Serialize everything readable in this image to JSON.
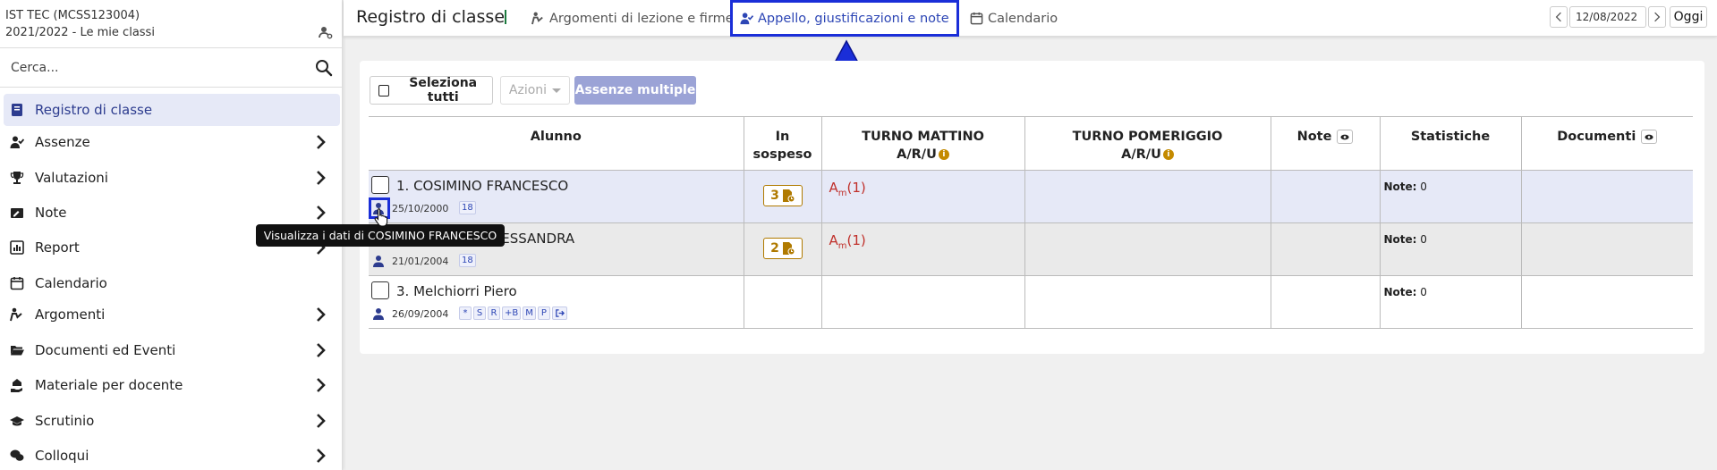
{
  "sidebar": {
    "school_name": "IST TEC (MCSS123004)",
    "school_year": "2021/2022 - Le mie classi",
    "search_placeholder": "Cerca...",
    "items": [
      {
        "label": "Registro di classe",
        "icon": "book-icon",
        "active": true,
        "chevron": false
      },
      {
        "label": "Assenze",
        "icon": "user-check-icon",
        "chevron": true
      },
      {
        "label": "Valutazioni",
        "icon": "trophy-icon",
        "chevron": true
      },
      {
        "label": "Note",
        "icon": "note-edit-icon",
        "chevron": true
      },
      {
        "label": "Report",
        "icon": "chart-icon",
        "chevron": true
      },
      {
        "label": "Calendario",
        "icon": "calendar-icon",
        "chevron": false
      },
      {
        "label": "Argomenti",
        "icon": "person-chalkboard-icon",
        "chevron": true
      },
      {
        "label": "Documenti ed Eventi",
        "icon": "folder-open-icon",
        "chevron": true
      },
      {
        "label": "Materiale per docente",
        "icon": "hand-holding-icon",
        "chevron": true
      },
      {
        "label": "Scrutinio",
        "icon": "graduation-cap-icon",
        "chevron": true
      },
      {
        "label": "Colloqui",
        "icon": "comments-icon",
        "chevron": true
      }
    ]
  },
  "topbar": {
    "title": "Registro di classe",
    "tabs": [
      {
        "label": "Argomenti di lezione e firme",
        "icon": "person-chalkboard-icon"
      },
      {
        "label": "Appello, giustificazioni e note",
        "icon": "user-check-icon",
        "active": true
      },
      {
        "label": "Calendario",
        "icon": "calendar-icon"
      }
    ],
    "date": "12/08/2022",
    "today_label": "Oggi"
  },
  "toolbar": {
    "select_all_label": "Seleziona tutti",
    "actions_label": "Azioni",
    "multiple_absences_label": "Assenze multiple"
  },
  "table": {
    "headers": {
      "alunno": "Alunno",
      "in_sospeso": "In sospeso",
      "turno_mattino": "TURNO MATTINO",
      "turno_mattino_sub": "A/R/U",
      "turno_pomeriggio": "TURNO POMERIGGIO",
      "turno_pomeriggio_sub": "A/R/U",
      "note": "Note",
      "statistiche": "Statistiche",
      "documenti": "Documenti"
    },
    "rows": [
      {
        "name": "1. COSIMINO FRANCESCO",
        "dob": "25/10/2000",
        "tags": [
          "18"
        ],
        "pending": "3",
        "absence_main": "A",
        "absence_sub": "m",
        "absence_count": "(1)",
        "stat_label": "Note:",
        "stat_value": "0"
      },
      {
        "name": "2. ESPOSITO ALESSANDRA",
        "dob": "21/01/2004",
        "tags": [
          "18"
        ],
        "pending": "2",
        "absence_main": "A",
        "absence_sub": "m",
        "absence_count": "(1)",
        "stat_label": "Note:",
        "stat_value": "0"
      },
      {
        "name": "3. Melchiorri Piero",
        "dob": "26/09/2004",
        "tags": [
          "*",
          "S",
          "R",
          "+B",
          "M",
          "P"
        ],
        "pending": "",
        "absence_main": "",
        "absence_sub": "",
        "absence_count": "",
        "stat_label": "Note:",
        "stat_value": "0"
      }
    ]
  },
  "tooltip": "Visualizza i dati di COSIMINO FRANCESCO",
  "colors": {
    "accent": "#2d46b5",
    "highlight_border": "#1a2ed8",
    "pending": "#b07a00",
    "absence": "#c0302b",
    "active_row": "#e6e9f7"
  }
}
